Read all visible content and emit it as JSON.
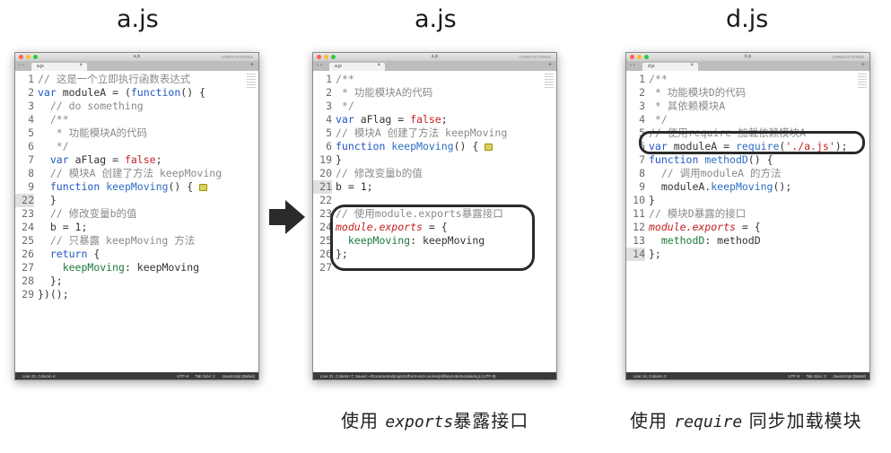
{
  "panels": [
    {
      "heading": "a.js",
      "window_title": "a.js",
      "tab_label": "a.js",
      "unregistered": "UNREGISTERED",
      "status_left": "Line 22, Column 4",
      "status_right": "UTF-8      Tab Size: 2      JavaScript (Babel)",
      "lines": [
        {
          "n": "1",
          "code": "// 这是一个立即执行函数表达式",
          "cls": "c"
        },
        {
          "n": "2",
          "code": "var moduleA = (function() {"
        },
        {
          "n": "3",
          "code": "  // do something",
          "cls": "c"
        },
        {
          "n": "4",
          "code": "  /**",
          "cls": "c"
        },
        {
          "n": "5",
          "code": "   * 功能模块A的代码",
          "cls": "c"
        },
        {
          "n": "6",
          "code": "   */",
          "cls": "c"
        },
        {
          "n": "7",
          "code": "  var aFlag = false;"
        },
        {
          "n": "8",
          "code": "  // 模块A 创建了方法 keepMoving",
          "cls": "c"
        },
        {
          "n": "9",
          "code": "  function keepMoving() {",
          "fold": true
        },
        {
          "n": "22",
          "code": "  }",
          "cur": true
        },
        {
          "n": "23",
          "code": "  // 修改变量b的值",
          "cls": "c"
        },
        {
          "n": "24",
          "code": "  b = 1;"
        },
        {
          "n": "25",
          "code": "  // 只暴露 keepMoving 方法",
          "cls": "c"
        },
        {
          "n": "26",
          "code": "  return {"
        },
        {
          "n": "27",
          "code": "    keepMoving: keepMoving"
        },
        {
          "n": "28",
          "code": "  };"
        },
        {
          "n": "29",
          "code": "})();"
        }
      ]
    },
    {
      "heading": "a.js",
      "window_title": "a.js",
      "tab_label": "a.js",
      "unregistered": "UNREGISTERED",
      "status_left": "Line 21, Column 7; Saved ~/Documents/projects/front-end-course/jsll/keynote/module/a.js (UTF-8)",
      "status_right": "",
      "lines": [
        {
          "n": "1",
          "code": "/**",
          "cls": "c"
        },
        {
          "n": "2",
          "code": " * 功能模块A的代码",
          "cls": "c"
        },
        {
          "n": "3",
          "code": " */",
          "cls": "c"
        },
        {
          "n": "4",
          "code": "var aFlag = false;"
        },
        {
          "n": "5",
          "code": "// 模块A 创建了方法 keepMoving",
          "cls": "c"
        },
        {
          "n": "6",
          "code": "function keepMoving() {",
          "fold": true
        },
        {
          "n": "19",
          "code": "}"
        },
        {
          "n": "20",
          "code": "// 修改变量b的值",
          "cls": "c"
        },
        {
          "n": "21",
          "code": "b = 1;",
          "cur": true
        },
        {
          "n": "22",
          "code": ""
        },
        {
          "n": "23",
          "code": "// 使用module.exports暴露接口",
          "cls": "c"
        },
        {
          "n": "24",
          "code": "module.exports = {"
        },
        {
          "n": "25",
          "code": "  keepMoving: keepMoving"
        },
        {
          "n": "26",
          "code": "};"
        },
        {
          "n": "27",
          "code": ""
        }
      ]
    },
    {
      "heading": "d.js",
      "window_title": "d.js",
      "tab_label": "d.js",
      "unregistered": "UNREGISTERED",
      "status_left": "Line 14, Column 2",
      "status_right": "UTF-8      Tab Size: 2      JavaScript (Babel)",
      "lines": [
        {
          "n": "1",
          "code": "/**",
          "cls": "c"
        },
        {
          "n": "2",
          "code": " * 功能模块D的代码",
          "cls": "c"
        },
        {
          "n": "3",
          "code": " * 其依赖模块A",
          "cls": "c"
        },
        {
          "n": "4",
          "code": " */",
          "cls": "c"
        },
        {
          "n": "5",
          "code": "// 使用require 加载依赖模块A",
          "cls": "c"
        },
        {
          "n": "6",
          "code": "var moduleA = require('./a.js');"
        },
        {
          "n": "7",
          "code": "function methodD() {"
        },
        {
          "n": "8",
          "code": "  // 调用moduleA 的方法",
          "cls": "c"
        },
        {
          "n": "9",
          "code": "  moduleA.keepMoving();"
        },
        {
          "n": "10",
          "code": "}"
        },
        {
          "n": "11",
          "code": "// 模块D暴露的接口",
          "cls": "c"
        },
        {
          "n": "12",
          "code": "module.exports = {"
        },
        {
          "n": "13",
          "code": "  methodD: methodD"
        },
        {
          "n": "14",
          "code": "};",
          "cur": true
        }
      ]
    }
  ],
  "captions": {
    "middle_prefix": "使用 ",
    "middle_code": "exports",
    "middle_suffix": "暴露接口",
    "right_prefix": "使用 ",
    "right_code": "require",
    "right_suffix": " 同步加载模块"
  },
  "colors": {
    "keyword": "#1f56c4",
    "string": "#c41f1f",
    "comment": "#8a8a8a",
    "arrow": "#2a2a2a",
    "highlight_ring": "#2a2a2a"
  },
  "icons": {
    "arrow": "right-arrow-icon",
    "fold": "fold-marker-icon"
  }
}
